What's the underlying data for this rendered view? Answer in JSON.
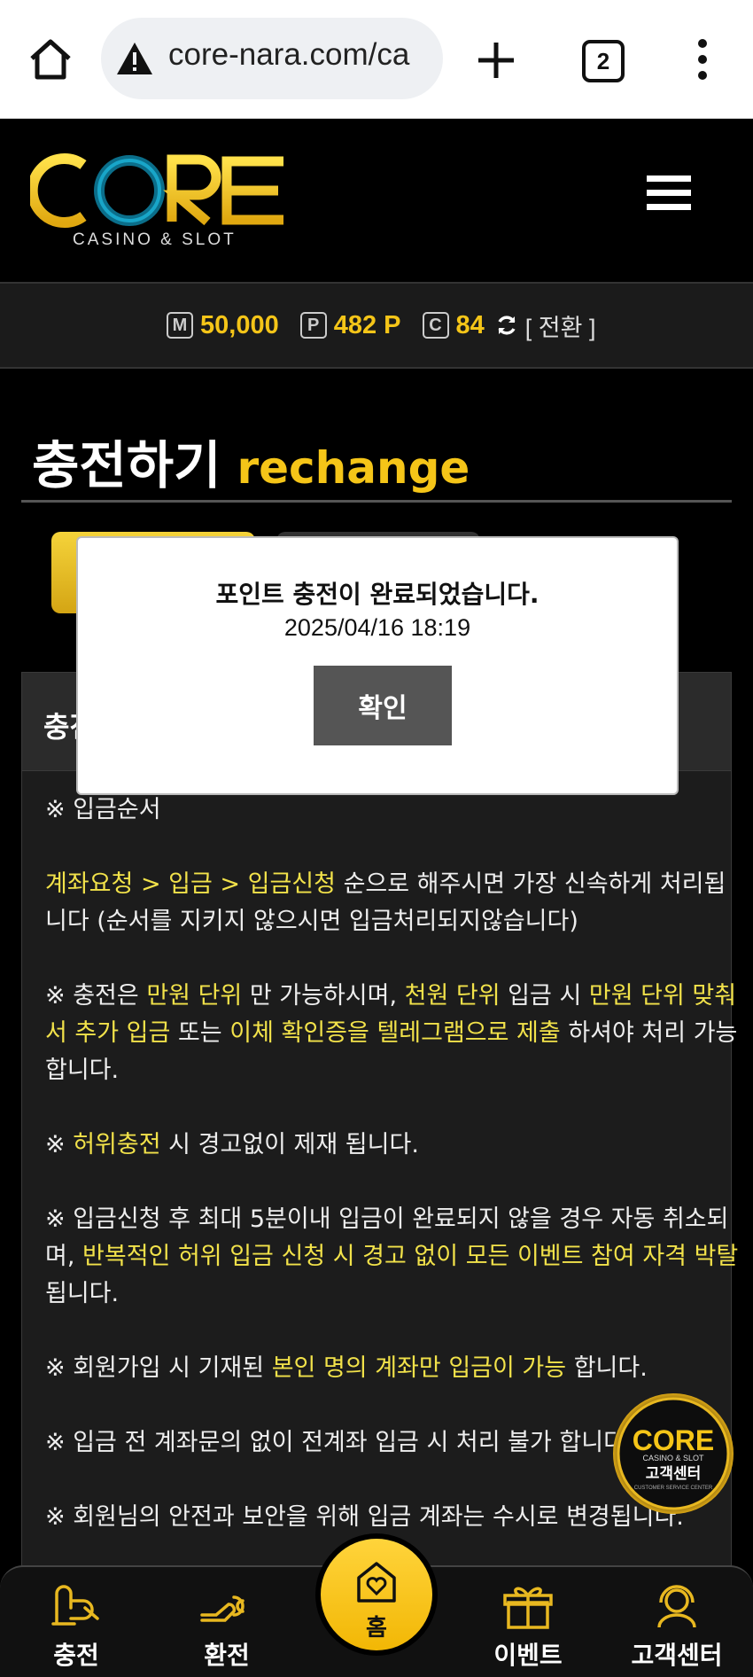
{
  "browser": {
    "url": "core-nara.com/ca",
    "tab_count": "2"
  },
  "site": {
    "logo_text": "CORE",
    "logo_sub": "CASINO & SLOT"
  },
  "balance": {
    "m_badge": "M",
    "m_value": "50,000",
    "p_badge": "P",
    "p_value": "482 P",
    "c_badge": "C",
    "c_value": "84",
    "convert_label": "[ 전환 ]"
  },
  "page": {
    "title_ko": "충전하기",
    "title_en": "rechange",
    "panel_label": "충전"
  },
  "notes": {
    "n1": "※ 입금순서",
    "n2_hl": "계좌요청 > 입금 > 입금신청",
    "n2_rest": " 순으로 해주시면 가장 신속하게 처리됩니다 (순서를 지키지 않으시면 입금처리되지않습니다)",
    "n3_a": "※ 충전은 ",
    "n3_b": "만원 단위",
    "n3_c": " 만 가능하시며, ",
    "n3_d": "천원 단위",
    "n3_e": " 입금 시 ",
    "n3_f": "만원 단위 맞춰서 추가 입금",
    "n3_g": " 또는 ",
    "n3_h": "이체 확인증을 텔레그램으로 제출",
    "n3_i": " 하셔야 처리 가능합니다.",
    "n4_a": "※ ",
    "n4_b": "허위충전",
    "n4_c": " 시 경고없이 제재 됩니다.",
    "n5_a": "※ 입금신청 후 최대 5분이내 입금이 완료되지 않을 경우 자동 취소되며, ",
    "n5_b": "반복적인 허위 입금 신청 시 경고 없이 모든 이벤트 참여 자격 박탈",
    "n5_c": "됩니다.",
    "n6_a": "※ 회원가입 시 기재된 ",
    "n6_b": "본인 명의 계좌만 입금이 가능",
    "n6_c": " 합니다.",
    "n7": "※ 입금 전 계좌문의 없이 전계좌 입금 시 처리 불가 합니다.",
    "n8": "※ 회원님의 안전과 보안을 위해 입금 계좌는 수시로 변경됩니다."
  },
  "modal": {
    "message": "포인트 충전이 완료되었습니다.",
    "timestamp": "2025/04/16 18:19",
    "ok_label": "확인"
  },
  "cs_badge": {
    "logo": "CORE",
    "sub": "CASINO & SLOT",
    "label": "고객센터",
    "caption": "CUSTOMER SERVICE CENTER"
  },
  "nav": {
    "deposit": "충전",
    "exchange": "환전",
    "home": "홈",
    "event": "이벤트",
    "support": "고객센터"
  },
  "colors": {
    "accent": "#f5c518",
    "highlight": "#f2e24a",
    "background": "#000000"
  }
}
